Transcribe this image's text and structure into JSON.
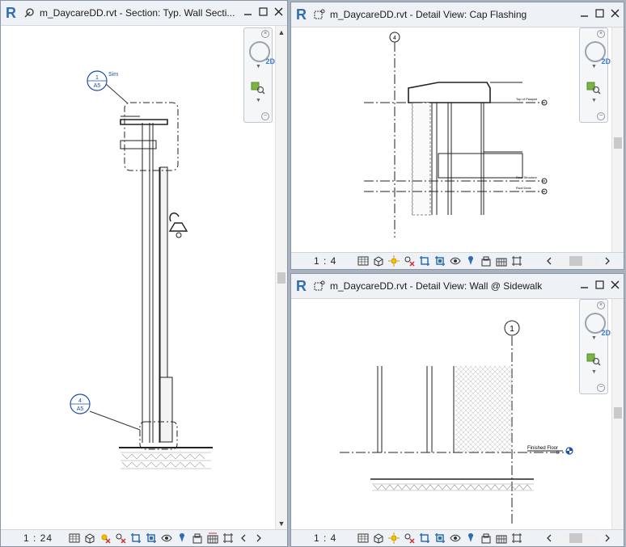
{
  "windows": [
    {
      "id": "section",
      "title": "m_DaycareDD.rvt - Section: Typ. Wall Secti...",
      "scale": "1 : 24",
      "labels": {
        "callout_top": "1",
        "callout_top_sheet": "A5",
        "callout_sim": "Sim",
        "callout_bottom": "4",
        "callout_bottom_sheet": "A5"
      }
    },
    {
      "id": "cap",
      "title": "m_DaycareDD.rvt - Detail View: Cap Flashing",
      "scale": "1 : 4",
      "labels": {
        "grid": "4",
        "level1": "Top of Parapet",
        "level2": "Roof Structure",
        "level3": "Roof Deck"
      }
    },
    {
      "id": "sidewalk",
      "title": "m_DaycareDD.rvt - Detail View: Wall @ Sidewalk",
      "scale": "1 : 4",
      "labels": {
        "grid": "1",
        "level": "Finished Floor",
        "level_value": "0"
      }
    }
  ],
  "navbar": {
    "wheel_label": "2D"
  },
  "icons": [
    "detail-level-icon",
    "visual-style-icon",
    "sun-path-icon",
    "shadows-icon",
    "crop-view-icon",
    "show-crop-icon",
    "temporary-hide-icon",
    "reveal-hidden-icon",
    "lock-3d-icon",
    "analysis-display-icon",
    "highlight-displacement-icon",
    "reveal-constraints-icon"
  ],
  "colors": {
    "accent": "#2f6eb5",
    "callout": "#1f4fa8"
  }
}
